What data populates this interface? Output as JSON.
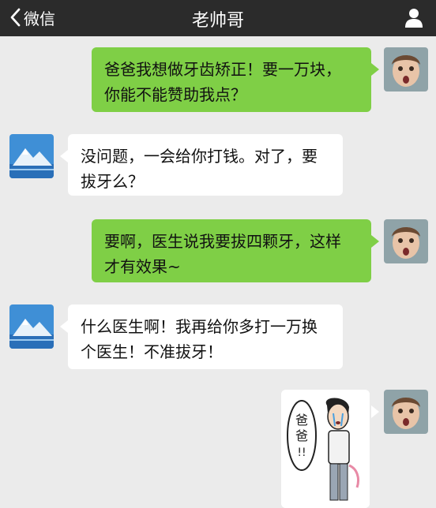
{
  "nav": {
    "back_label": "微信",
    "title": "老帅哥"
  },
  "messages": [
    {
      "sender": "me",
      "lines": [
        "爸爸我想做牙齿矫正！要一万块，",
        "你能不能赞助我点？"
      ]
    },
    {
      "sender": "them",
      "lines": [
        "没问题，一会给你打钱。对了，要",
        "拔牙么？"
      ]
    },
    {
      "sender": "me",
      "lines": [
        "要啊，医生说我要拔四颗牙，这样",
        "才有效果~"
      ]
    },
    {
      "sender": "them",
      "lines": [
        "什么医生啊！我再给你多打一万换",
        "个医生！不准拔牙！"
      ]
    }
  ],
  "sticker": {
    "speech_text": "爸爸!!"
  },
  "colors": {
    "nav_bg": "#2b2b2b",
    "chat_bg": "#ebebeb",
    "my_bubble": "#7fcf46",
    "their_bubble": "#ffffff"
  },
  "icons": {
    "back": "chevron-left-icon",
    "profile": "person-icon"
  }
}
